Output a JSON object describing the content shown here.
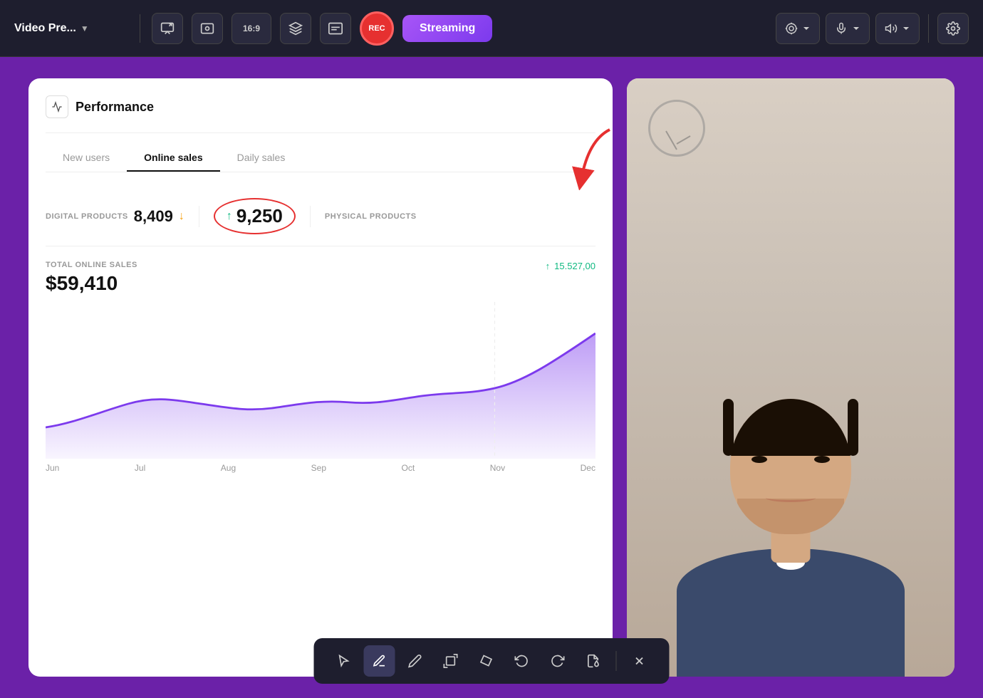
{
  "toolbar": {
    "title": "Video Pre...",
    "aspect_ratio": "16:9",
    "rec_label": "REC",
    "streaming_label": "Streaming"
  },
  "dashboard": {
    "title": "Performance",
    "tabs": [
      {
        "label": "New users",
        "active": false
      },
      {
        "label": "Online sales",
        "active": true
      },
      {
        "label": "Daily sales",
        "active": false
      }
    ],
    "metrics": {
      "digital_products_label": "DIGITAL PRODUCTS",
      "digital_products_value": "8,409",
      "physical_products_label": "PHYSICAL PRODUCTS",
      "highlighted_value": "9,250"
    },
    "chart": {
      "total_label": "TOTAL ONLINE SALES",
      "total_value": "$59,410",
      "legend_value": "15.527,00",
      "x_labels": [
        "Jun",
        "Jul",
        "Aug",
        "Sep",
        "Oct",
        "Nov",
        "Dec"
      ]
    }
  },
  "annotation_toolbar": {
    "tools": [
      {
        "name": "cursor",
        "label": "▷",
        "active": false
      },
      {
        "name": "pen",
        "label": "✏",
        "active": true
      },
      {
        "name": "pencil",
        "label": "◇",
        "active": false
      },
      {
        "name": "crop",
        "label": "⊡",
        "active": false
      },
      {
        "name": "eraser",
        "label": "◆",
        "active": false
      },
      {
        "name": "undo",
        "label": "↩",
        "active": false
      },
      {
        "name": "redo",
        "label": "↪",
        "active": false
      },
      {
        "name": "bucket",
        "label": "⛣",
        "active": false
      },
      {
        "name": "close",
        "label": "✕",
        "active": false
      }
    ]
  }
}
